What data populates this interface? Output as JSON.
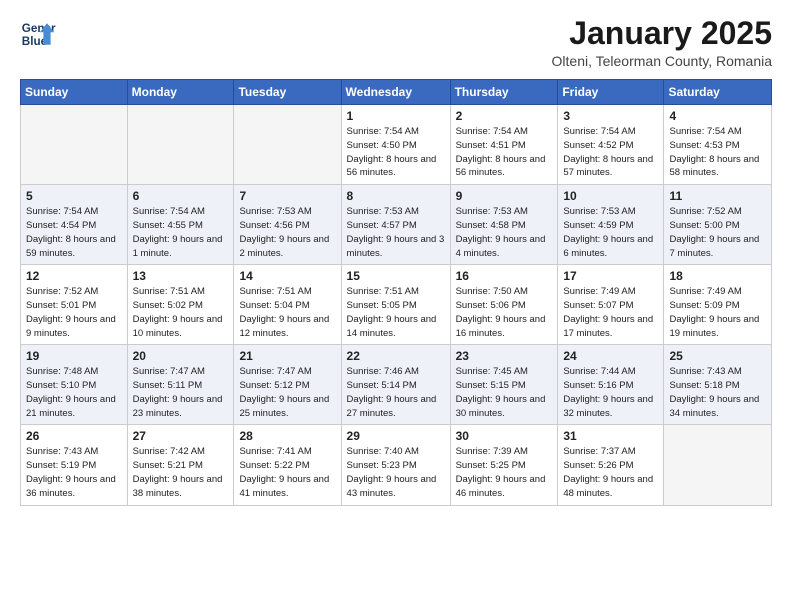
{
  "logo": {
    "line1": "General",
    "line2": "Blue"
  },
  "title": "January 2025",
  "location": "Olteni, Teleorman County, Romania",
  "weekdays": [
    "Sunday",
    "Monday",
    "Tuesday",
    "Wednesday",
    "Thursday",
    "Friday",
    "Saturday"
  ],
  "weeks": [
    [
      {
        "day": "",
        "empty": true
      },
      {
        "day": "",
        "empty": true
      },
      {
        "day": "",
        "empty": true
      },
      {
        "day": "1",
        "sunrise": "7:54 AM",
        "sunset": "4:50 PM",
        "daylight": "8 hours and 56 minutes."
      },
      {
        "day": "2",
        "sunrise": "7:54 AM",
        "sunset": "4:51 PM",
        "daylight": "8 hours and 56 minutes."
      },
      {
        "day": "3",
        "sunrise": "7:54 AM",
        "sunset": "4:52 PM",
        "daylight": "8 hours and 57 minutes."
      },
      {
        "day": "4",
        "sunrise": "7:54 AM",
        "sunset": "4:53 PM",
        "daylight": "8 hours and 58 minutes."
      }
    ],
    [
      {
        "day": "5",
        "sunrise": "7:54 AM",
        "sunset": "4:54 PM",
        "daylight": "8 hours and 59 minutes."
      },
      {
        "day": "6",
        "sunrise": "7:54 AM",
        "sunset": "4:55 PM",
        "daylight": "9 hours and 1 minute."
      },
      {
        "day": "7",
        "sunrise": "7:53 AM",
        "sunset": "4:56 PM",
        "daylight": "9 hours and 2 minutes."
      },
      {
        "day": "8",
        "sunrise": "7:53 AM",
        "sunset": "4:57 PM",
        "daylight": "9 hours and 3 minutes."
      },
      {
        "day": "9",
        "sunrise": "7:53 AM",
        "sunset": "4:58 PM",
        "daylight": "9 hours and 4 minutes."
      },
      {
        "day": "10",
        "sunrise": "7:53 AM",
        "sunset": "4:59 PM",
        "daylight": "9 hours and 6 minutes."
      },
      {
        "day": "11",
        "sunrise": "7:52 AM",
        "sunset": "5:00 PM",
        "daylight": "9 hours and 7 minutes."
      }
    ],
    [
      {
        "day": "12",
        "sunrise": "7:52 AM",
        "sunset": "5:01 PM",
        "daylight": "9 hours and 9 minutes."
      },
      {
        "day": "13",
        "sunrise": "7:51 AM",
        "sunset": "5:02 PM",
        "daylight": "9 hours and 10 minutes."
      },
      {
        "day": "14",
        "sunrise": "7:51 AM",
        "sunset": "5:04 PM",
        "daylight": "9 hours and 12 minutes."
      },
      {
        "day": "15",
        "sunrise": "7:51 AM",
        "sunset": "5:05 PM",
        "daylight": "9 hours and 14 minutes."
      },
      {
        "day": "16",
        "sunrise": "7:50 AM",
        "sunset": "5:06 PM",
        "daylight": "9 hours and 16 minutes."
      },
      {
        "day": "17",
        "sunrise": "7:49 AM",
        "sunset": "5:07 PM",
        "daylight": "9 hours and 17 minutes."
      },
      {
        "day": "18",
        "sunrise": "7:49 AM",
        "sunset": "5:09 PM",
        "daylight": "9 hours and 19 minutes."
      }
    ],
    [
      {
        "day": "19",
        "sunrise": "7:48 AM",
        "sunset": "5:10 PM",
        "daylight": "9 hours and 21 minutes."
      },
      {
        "day": "20",
        "sunrise": "7:47 AM",
        "sunset": "5:11 PM",
        "daylight": "9 hours and 23 minutes."
      },
      {
        "day": "21",
        "sunrise": "7:47 AM",
        "sunset": "5:12 PM",
        "daylight": "9 hours and 25 minutes."
      },
      {
        "day": "22",
        "sunrise": "7:46 AM",
        "sunset": "5:14 PM",
        "daylight": "9 hours and 27 minutes."
      },
      {
        "day": "23",
        "sunrise": "7:45 AM",
        "sunset": "5:15 PM",
        "daylight": "9 hours and 30 minutes."
      },
      {
        "day": "24",
        "sunrise": "7:44 AM",
        "sunset": "5:16 PM",
        "daylight": "9 hours and 32 minutes."
      },
      {
        "day": "25",
        "sunrise": "7:43 AM",
        "sunset": "5:18 PM",
        "daylight": "9 hours and 34 minutes."
      }
    ],
    [
      {
        "day": "26",
        "sunrise": "7:43 AM",
        "sunset": "5:19 PM",
        "daylight": "9 hours and 36 minutes."
      },
      {
        "day": "27",
        "sunrise": "7:42 AM",
        "sunset": "5:21 PM",
        "daylight": "9 hours and 38 minutes."
      },
      {
        "day": "28",
        "sunrise": "7:41 AM",
        "sunset": "5:22 PM",
        "daylight": "9 hours and 41 minutes."
      },
      {
        "day": "29",
        "sunrise": "7:40 AM",
        "sunset": "5:23 PM",
        "daylight": "9 hours and 43 minutes."
      },
      {
        "day": "30",
        "sunrise": "7:39 AM",
        "sunset": "5:25 PM",
        "daylight": "9 hours and 46 minutes."
      },
      {
        "day": "31",
        "sunrise": "7:37 AM",
        "sunset": "5:26 PM",
        "daylight": "9 hours and 48 minutes."
      },
      {
        "day": "",
        "empty": true
      }
    ]
  ]
}
